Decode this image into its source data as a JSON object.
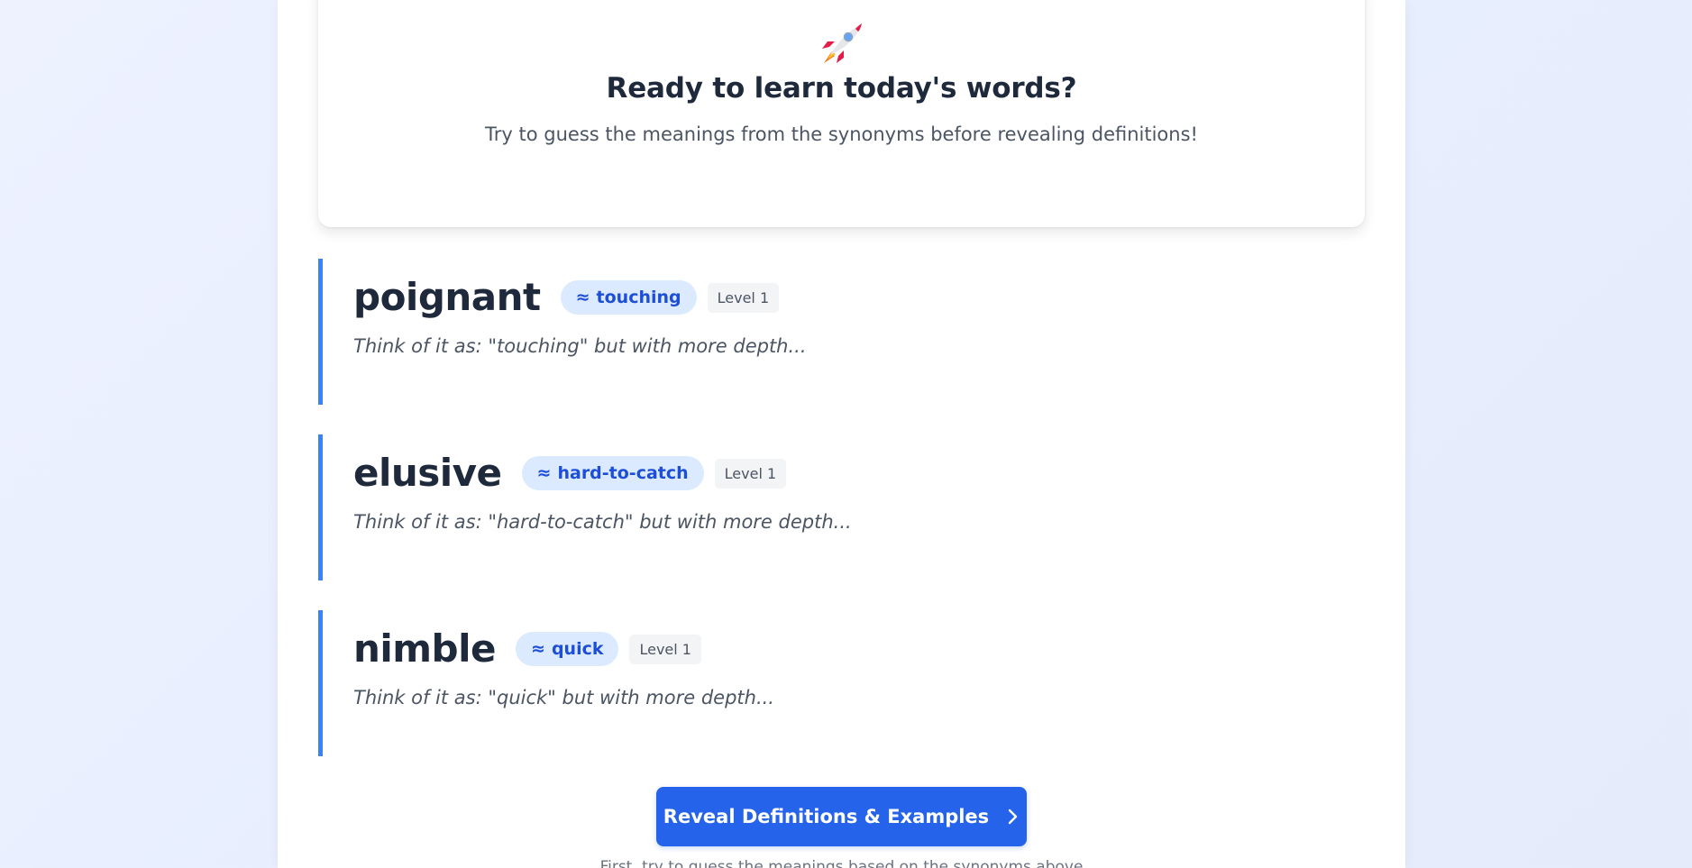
{
  "hero": {
    "icon": "rocket-icon",
    "title": "Ready to learn today's words?",
    "subtitle": "Try to guess the meanings from the synonyms before revealing definitions!"
  },
  "words": [
    {
      "word": "poignant",
      "synonym_label": "touching",
      "level": "Level 1",
      "hint": "Think of it as: \"touching\" but with more depth..."
    },
    {
      "word": "elusive",
      "synonym_label": "hard-to-catch",
      "level": "Level 1",
      "hint": "Think of it as: \"hard-to-catch\" but with more depth..."
    },
    {
      "word": "nimble",
      "synonym_label": "quick",
      "level": "Level 1",
      "hint": "Think of it as: \"quick\" but with more depth..."
    }
  ],
  "approx_symbol": "≈",
  "reveal_button": {
    "label": "Reveal Definitions & Examples",
    "icon": "chevron-right-icon"
  },
  "footer_hint": "First, try to guess the meanings based on the synonyms above",
  "colors": {
    "accent": "#2563eb",
    "card_border": "#3b82f6",
    "pill_bg": "#dbeafe",
    "pill_text": "#1d4ed8",
    "heading": "#1e293b",
    "muted": "#4b5563"
  }
}
